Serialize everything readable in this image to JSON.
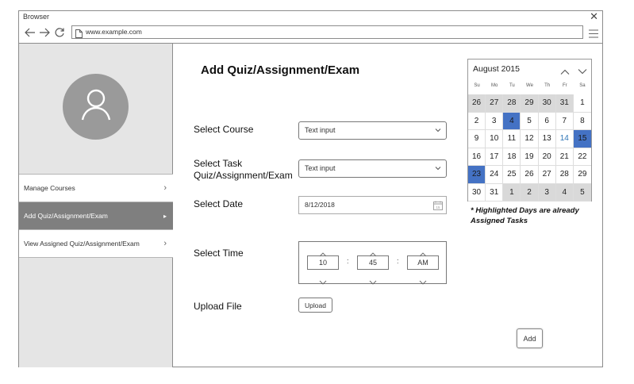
{
  "browser": {
    "title": "Browser",
    "close_glyph": "✕",
    "url": "www.example.com",
    "icons": [
      "back-arrow-icon",
      "forward-arrow-icon",
      "reload-icon",
      "document-icon",
      "hamburger-menu-icon"
    ]
  },
  "sidebar": {
    "avatar_icon": "user-icon",
    "items": [
      {
        "label": "Manage Courses",
        "chev": "›"
      },
      {
        "label": "Add Quiz/Assignment/Exam",
        "chev": "▸"
      },
      {
        "label": "View Assigned Quiz/Assignment/Exam",
        "chev": "›"
      }
    ],
    "active_index": 1
  },
  "main": {
    "title": "Add Quiz/Assignment/Exam",
    "course": {
      "label": "Select Course",
      "value": "Text input"
    },
    "task": {
      "label_line1": "Select Task",
      "label_line2": "Quiz/Assignment/Exam",
      "value": "Text input"
    },
    "date": {
      "label": "Select Date",
      "value": "8/12/2018"
    },
    "time": {
      "label": "Select Time",
      "hour": "10",
      "minute": "45",
      "ampm": "AM",
      "separator": ":"
    },
    "upload": {
      "label": "Upload File",
      "button": "Upload"
    },
    "add_button": "Add"
  },
  "calendar": {
    "month": "August 2015",
    "weekdays": [
      "Su",
      "Mo",
      "Tu",
      "We",
      "Th",
      "Fr",
      "Sa"
    ],
    "weeks": [
      [
        "26",
        "27",
        "28",
        "29",
        "30",
        "31",
        "1"
      ],
      [
        "2",
        "3",
        "4",
        "5",
        "6",
        "7",
        "8"
      ],
      [
        "9",
        "10",
        "11",
        "12",
        "13",
        "14",
        "15"
      ],
      [
        "16",
        "17",
        "18",
        "19",
        "20",
        "21",
        "22"
      ],
      [
        "23",
        "24",
        "25",
        "26",
        "27",
        "28",
        "29"
      ],
      [
        "30",
        "31",
        "1",
        "2",
        "3",
        "4",
        "5"
      ]
    ],
    "other_month_cells": [
      [
        0,
        0
      ],
      [
        0,
        1
      ],
      [
        0,
        2
      ],
      [
        0,
        3
      ],
      [
        0,
        4
      ],
      [
        0,
        5
      ],
      [
        5,
        2
      ],
      [
        5,
        3
      ],
      [
        5,
        4
      ],
      [
        5,
        5
      ],
      [
        5,
        6
      ]
    ],
    "highlighted_cells": [
      [
        1,
        2
      ],
      [
        2,
        6
      ],
      [
        4,
        0
      ]
    ],
    "today_cell": [
      2,
      5
    ],
    "highlight_color": "#4472c4",
    "note_line1": "* Highlighted Days are already",
    "note_line2": "Assigned Tasks"
  },
  "colors": {
    "sidebar_bg": "#e5e5e5",
    "active_item_bg": "#7f7f7f",
    "avatar_bg": "#9a9a9a"
  }
}
